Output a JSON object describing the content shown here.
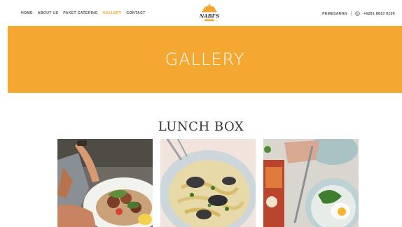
{
  "header": {
    "nav": [
      {
        "label": "HOME",
        "active": false
      },
      {
        "label": "ABOUT US",
        "active": false
      },
      {
        "label": "PAKET CATERING",
        "active": false
      },
      {
        "label": "GALLERY",
        "active": true
      },
      {
        "label": "CONTACT",
        "active": false
      }
    ],
    "logo_text": "NABI'S",
    "order_label": "PEMESANAN",
    "phone": "+6281 8810 8109",
    "phone_icon": "whatsapp-icon"
  },
  "banner": {
    "title": "GALLERY",
    "color": "#f4a831"
  },
  "section": {
    "title": "LUNCH BOX"
  },
  "colors": {
    "accent": "#f5a623",
    "banner": "#f4a831",
    "text": "#333333"
  }
}
